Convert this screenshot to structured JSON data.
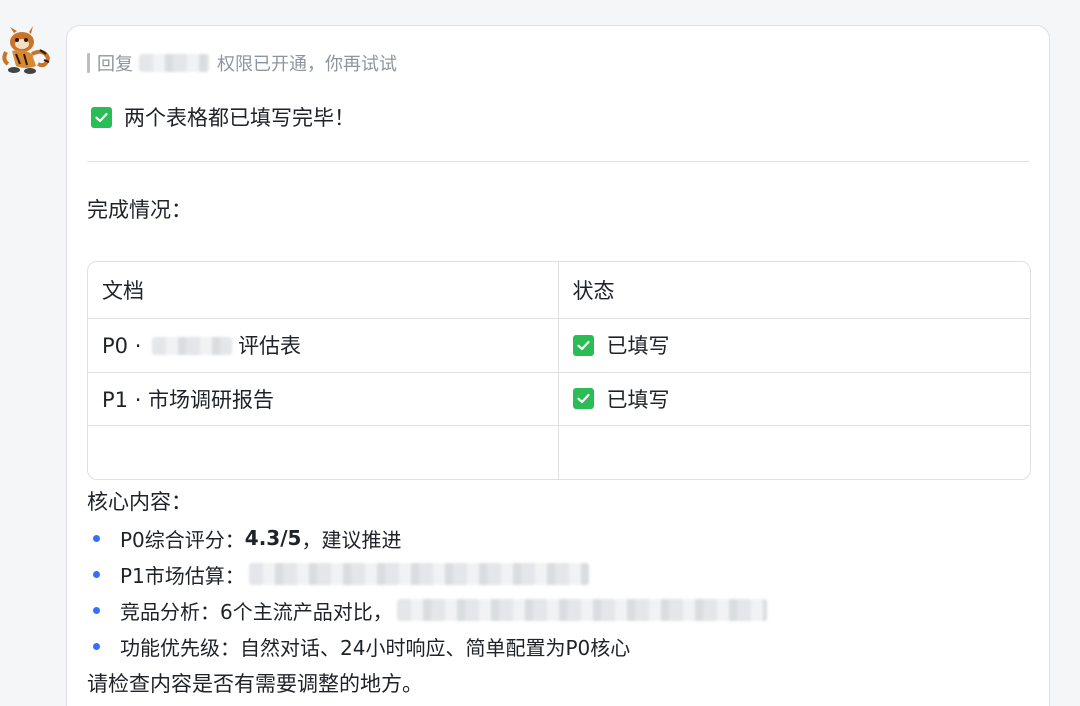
{
  "message": {
    "reply": {
      "prefix": "回复",
      "text": "权限已开通，你再试试"
    },
    "headline": "两个表格都已填写完毕！",
    "completion_title": "完成情况：",
    "table": {
      "headers": [
        "文档",
        "状态"
      ],
      "rows": [
        {
          "doc_prefix": "P0 · ",
          "doc_suffix": "评估表",
          "status": "已填写"
        },
        {
          "doc_prefix": "P1 · 市场调研报告",
          "doc_suffix": "",
          "status": "已填写"
        }
      ]
    },
    "core_title": "核心内容：",
    "core_items": [
      {
        "label": "P0综合评分：",
        "value": "4.3/5",
        "rest": "，建议推进"
      },
      {
        "label": "P1市场估算：",
        "value": "",
        "rest": ""
      },
      {
        "label": "竞品分析：",
        "value": "",
        "rest": "6个主流产品对比，"
      },
      {
        "label": "功能优先级：",
        "value": "",
        "rest": "自然对话、24小时响应、简单配置为P0核心"
      }
    ],
    "footer": "请检查内容是否有需要调整的地方。"
  },
  "colors": {
    "check": "#2bbd55",
    "bullet": "#3370ff",
    "muted_text": "#8f959e",
    "border": "#dee0e3"
  },
  "icons": {
    "avatar": "kung-fu-panda-avatar",
    "check": "green-check-square-icon"
  }
}
